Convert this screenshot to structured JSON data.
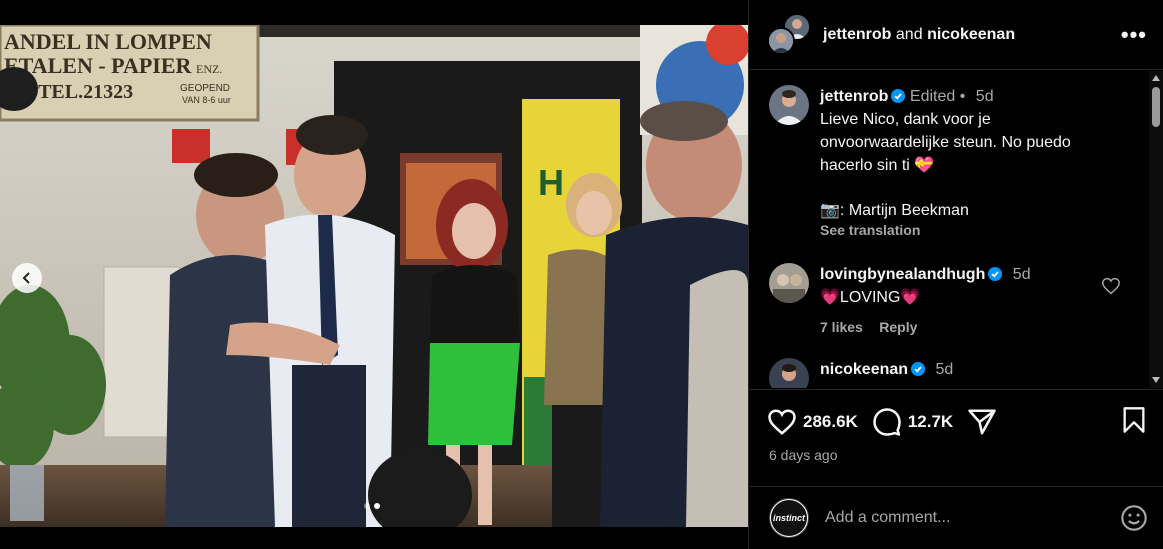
{
  "post": {
    "carousel": {
      "total_slides": 2,
      "active_slide": 1
    }
  },
  "sign_text": {
    "line1": "ANDEL IN LOMPEN",
    "line2": "ETALEN - PAPIER",
    "enz": "ENZ.",
    "line3": "R.4 TEL.21323",
    "geopend": "GEOPEND",
    "van": "VAN 8-6 uur"
  },
  "header": {
    "user1": "jettenrob",
    "and_word": "and",
    "user2": "nicokeenan",
    "more_label": "•••"
  },
  "caption": {
    "username": "jettenrob",
    "edited": "Edited",
    "separator": "•",
    "time": "5d",
    "text": "Lieve Nico, dank voor je onvoorwaardelijke steun. No puedo hacerlo sin ti 💝",
    "credit": "📷: Martijn Beekman",
    "see_translation": "See translation"
  },
  "comments": [
    {
      "username": "lovingbynealandhugh",
      "time": "5d",
      "text": "💗LOVING💗",
      "likes": "7 likes",
      "reply": "Reply"
    },
    {
      "username": "nicokeenan",
      "time": "5d"
    }
  ],
  "actions": {
    "likes": "286.6K",
    "comments": "12.7K",
    "time_ago": "6 days ago"
  },
  "add_comment": {
    "avatar_label": "instinct",
    "placeholder": "Add a comment..."
  },
  "colors": {
    "background": "#000000",
    "verified": "#0095f6",
    "secondary_text": "#a8a8a8",
    "divider": "#262626"
  }
}
